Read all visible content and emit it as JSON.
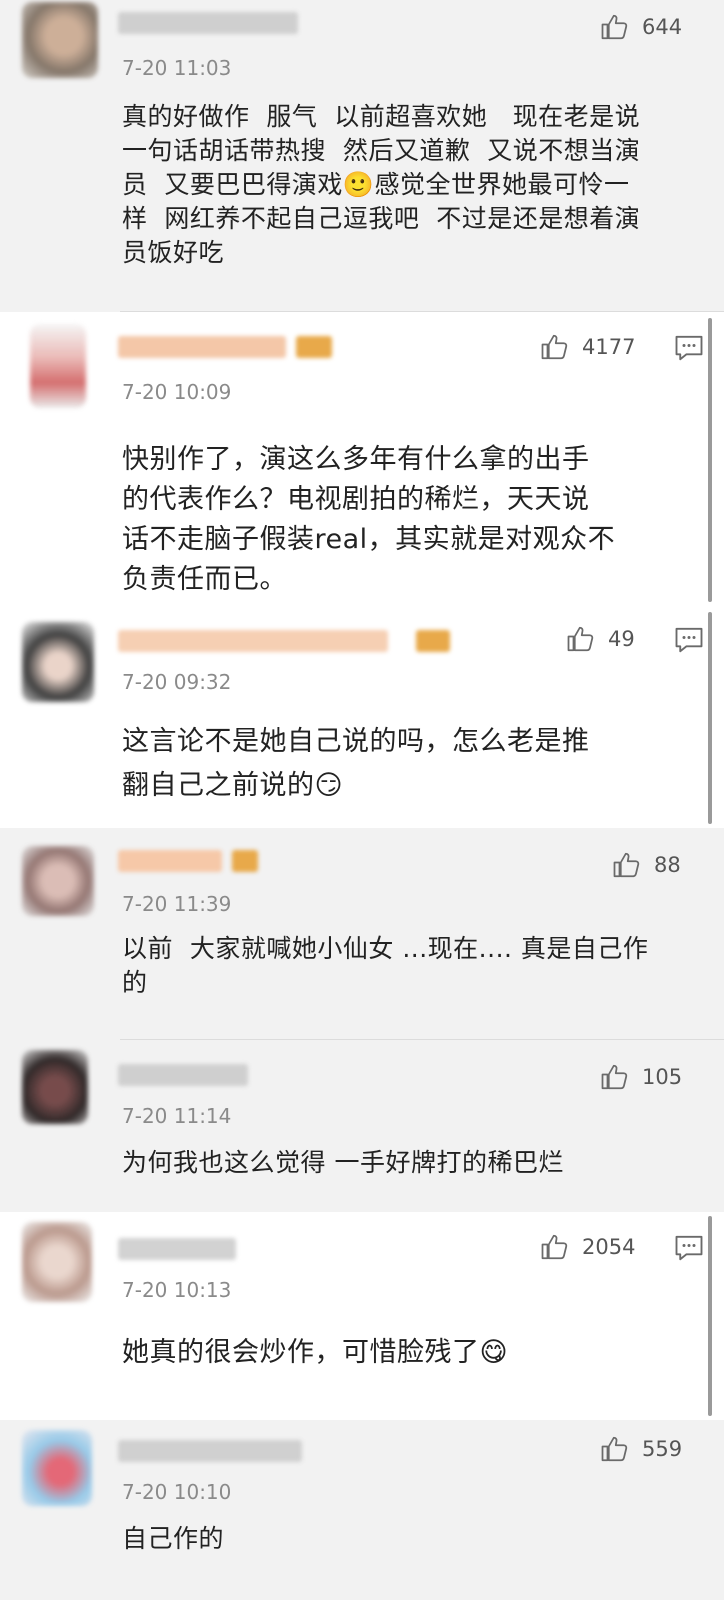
{
  "accent": "#e8a94a",
  "comments": [
    {
      "time": "7-20 11:03",
      "likes": "644",
      "text": "真的好做作  服气  以前超喜欢她   现在老是说\n一句话胡话带热搜  然后又道歉  又说不想当演\n员  又要巴巴得演戏🙂感觉全世界她最可怜一\n样  网红养不起自己逗我吧  不过是还是想着演\n员饭好吃"
    },
    {
      "time": "7-20 10:09",
      "likes": "4177",
      "text": "快别作了，演这么多年有什么拿的出手\n的代表作么？电视剧拍的稀烂，天天说\n话不走脑子假装real，其实就是对观众不\n负责任而已。"
    },
    {
      "time": "7-20 09:32",
      "likes": "49",
      "text": "这言论不是她自己说的吗，怎么老是推\n翻自己之前说的😏"
    },
    {
      "time": "7-20 11:39",
      "likes": "88",
      "text": "以前  大家就喊她小仙女 ...现在.... 真是自己作\n的"
    },
    {
      "time": "7-20 11:14",
      "likes": "105",
      "text": "为何我也这么觉得 一手好牌打的稀巴烂"
    },
    {
      "time": "7-20 10:13",
      "likes": "2054",
      "text": "她真的很会炒作，可惜脸残了😋"
    },
    {
      "time": "7-20 10:10",
      "likes": "559",
      "text": "自己作的"
    }
  ]
}
